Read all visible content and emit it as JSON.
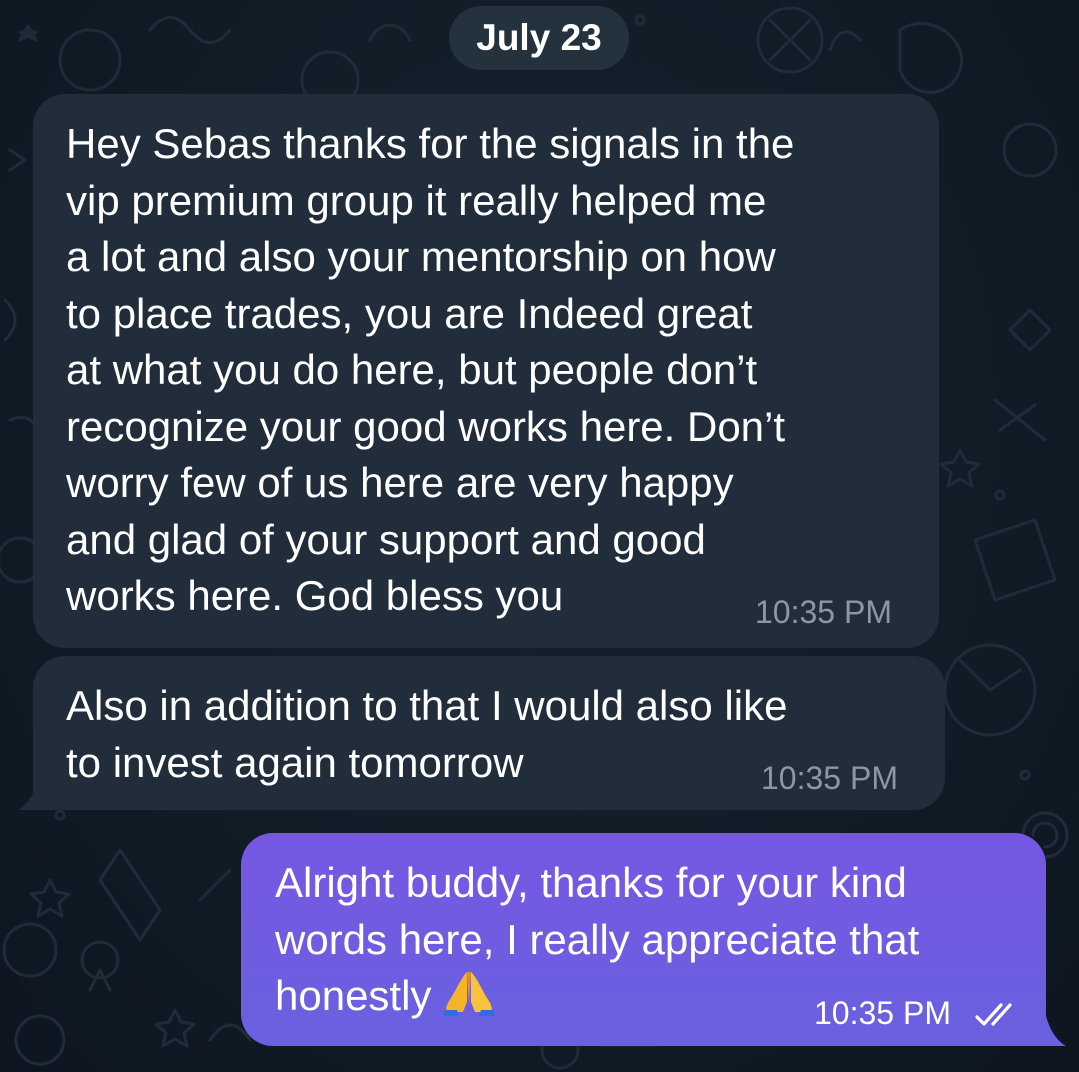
{
  "date_separator": "July 23",
  "messages": [
    {
      "direction": "incoming",
      "lines": [
        "Hey Sebas thanks for the signals in the",
        "vip premium group it really helped me",
        "a lot and also your mentorship on how",
        "to place trades, you are Indeed great",
        "at what you do here, but people don’t",
        "recognize your good works here. Don’t",
        "worry few of us here are very happy",
        "and glad of your support and good",
        "works here. God bless you"
      ],
      "time": "10:35 PM"
    },
    {
      "direction": "incoming",
      "lines": [
        "Also in addition to that I would also like",
        "to invest again tomorrow"
      ],
      "time": "10:35 PM"
    },
    {
      "direction": "outgoing",
      "lines": [
        "Alright buddy, thanks for your kind",
        "words here, I really appreciate that",
        "honestly"
      ],
      "emoji": "folded-hands-emoji",
      "time": "10:35 PM",
      "status": "read-double-check"
    }
  ],
  "colors": {
    "background": "#101b25",
    "incoming_bubble": "#212d3b",
    "outgoing_bubble": "#6b58dc",
    "timestamp_incoming": "#8a98a6"
  }
}
